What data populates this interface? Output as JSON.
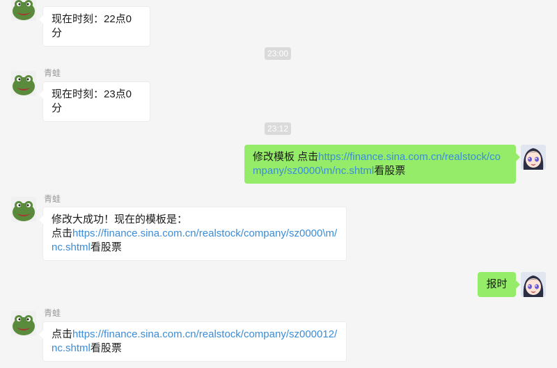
{
  "messages": [
    {
      "id": "m1",
      "sender": "青蛙",
      "text": "现在时刻：22点0分"
    },
    {
      "id": "t1",
      "time": "23:00"
    },
    {
      "id": "m2",
      "sender": "青蛙",
      "text": "现在时刻：23点0分"
    },
    {
      "id": "t2",
      "time": "23:12"
    },
    {
      "id": "m3",
      "prefix": "修改模板 点击",
      "link": "https://finance.sina.com.cn/realstock/company/sz0000\\m/nc.shtml",
      "suffix": "看股票"
    },
    {
      "id": "m4",
      "sender": "青蛙",
      "line1": "修改大成功！现在的模板是：",
      "prefix": "点击",
      "link": "https://finance.sina.com.cn/realstock/company/sz0000\\m/nc.shtml",
      "suffix": "看股票"
    },
    {
      "id": "m5",
      "text": "报时"
    },
    {
      "id": "m6",
      "sender": "青蛙",
      "prefix": "点击",
      "link": "https://finance.sina.com.cn/realstock/company/sz000012/nc.shtml",
      "suffix": "看股票"
    }
  ],
  "colors": {
    "outgoing_bubble": "#95ec69",
    "incoming_bubble": "#ffffff",
    "link": "#3b8cd8",
    "background": "#f5f5f5"
  },
  "icons": {
    "frog_avatar": "frog-avatar-icon",
    "anime_avatar": "anime-girl-avatar-icon"
  }
}
